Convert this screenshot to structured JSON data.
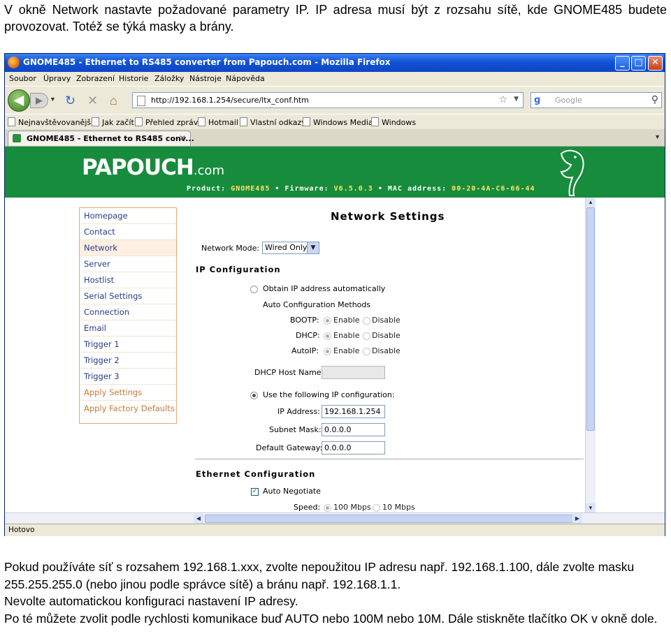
{
  "doc": {
    "intro": "V okně Network nastavte požadované parametry IP. IP adresa musí být z rozsahu sítě, kde GNOME485 budete provozovat. Totéž se týká masky a brány.",
    "para1": "Pokud používáte síť s rozsahem 192.168.1.xxx, zvolte nepoužitou IP adresu např. 192.168.1.100, dále zvolte masku 255.255.255.0 (nebo jinou podle správce sítě) a bránu např. 192.168.1.1.",
    "para2": "Nevolte automatickou konfiguraci nastavení IP adresy.",
    "para3": "Po té můžete zvolit podle rychlosti komunikace buď AUTO nebo 100M nebo 10M. Dále stiskněte tlačítko OK v okně dole."
  },
  "browser": {
    "title": "GNOME485 - Ethernet to RS485 converter from Papouch.com - Mozilla Firefox",
    "menu": [
      "Soubor",
      "Úpravy",
      "Zobrazení",
      "Historie",
      "Záložky",
      "Nástroje",
      "Nápověda"
    ],
    "url": "http://192.168.1.254/secure/ltx_conf.htm",
    "search_placeholder": "Google",
    "bookmarks": [
      "Nejnavštěvovanější",
      "Jak začít",
      "Přehled zpráv",
      "Hotmail",
      "Vlastní odkazy",
      "Windows Media",
      "Windows"
    ],
    "tab_title": "GNOME485 - Ethernet to RS485 conv...",
    "status": "Hotovo"
  },
  "site": {
    "logo_main": "PAPOUCH",
    "logo_suffix": ".com",
    "product_label": "Product:",
    "product": "GNOME485",
    "firmware_label": "Firmware:",
    "firmware": "V6.5.0.3",
    "mac_label": "MAC address:",
    "mac": "00-20-4A-C6-66-44",
    "menu": [
      "Homepage",
      "Contact",
      "Network",
      "Server",
      "Hostlist",
      "Serial Settings",
      "Connection",
      "Email",
      "Trigger 1",
      "Trigger 2",
      "Trigger 3",
      "Apply Settings",
      "Apply Factory Defaults"
    ]
  },
  "form": {
    "page_title": "Network Settings",
    "network_mode_label": "Network Mode:",
    "network_mode_value": "Wired Only",
    "ip_config_title": "IP Configuration",
    "obtain_auto": "Obtain IP address automatically",
    "auto_methods": "Auto Configuration Methods",
    "bootp_label": "BOOTP:",
    "dhcp_label": "DHCP:",
    "autoip_label": "AutoIP:",
    "enable": "Enable",
    "disable": "Disable",
    "dhcp_host_label": "DHCP Host Name:",
    "use_following": "Use the following IP configuration:",
    "ip_label": "IP Address:",
    "ip_value": "192.168.1.254",
    "mask_label": "Subnet Mask:",
    "mask_value": "0.0.0.0",
    "gateway_label": "Default Gateway:",
    "gateway_value": "0.0.0.0",
    "eth_title": "Ethernet Configuration",
    "auto_negotiate": "Auto Negotiate",
    "speed_label": "Speed:",
    "speed_100": "100 Mbps",
    "speed_10": "10 Mbps"
  }
}
